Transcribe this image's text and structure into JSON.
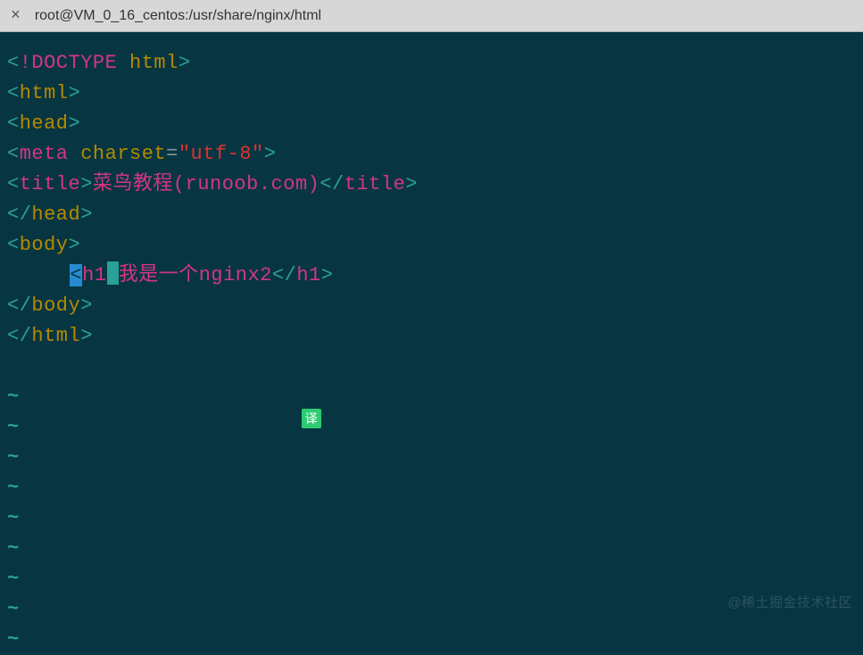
{
  "titlebar": {
    "close": "×",
    "title": "root@VM_0_16_centos:/usr/share/nginx/html"
  },
  "code": {
    "doctype_bang": "!DOCTYPE ",
    "doctype_html": "html",
    "html": "html",
    "head": "head",
    "meta": "meta ",
    "charset_attr": "charset",
    "eq": "=",
    "charset_val": "\"utf-8\"",
    "title": "title",
    "title_text": "菜鸟教程(runoob.com)",
    "head_close": "head",
    "body": "body",
    "h1": "h1",
    "h1_lt": "<",
    "h1_text": "我是一个nginx2",
    "body_close": "body",
    "html_close": "html",
    "tilde": "~"
  },
  "badge": {
    "translate": "译"
  },
  "watermark": "@稀土掘金技术社区"
}
